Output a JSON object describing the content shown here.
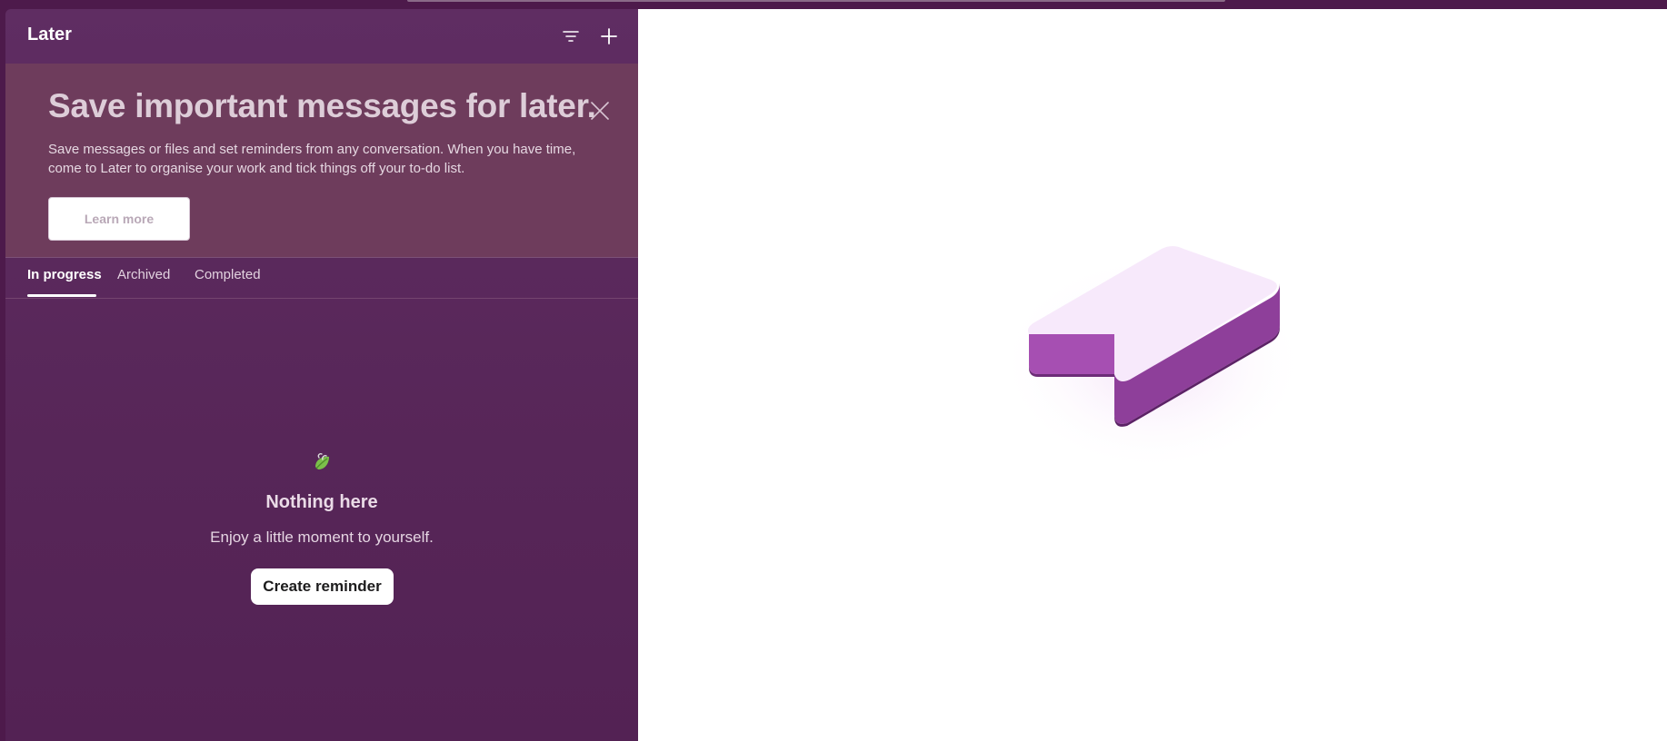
{
  "header": {
    "title": "Later",
    "filter_icon": "filter-icon",
    "add_icon": "plus-icon"
  },
  "banner": {
    "headline": "Save important messages for later.",
    "description": "Save messages or files and set reminders from any conversation. When you have time, come to Later to organise your work and tick things off your to-do list.",
    "learn_more_label": "Learn more",
    "close_icon": "close-icon"
  },
  "tabs": [
    {
      "label": "In progress",
      "active": true
    },
    {
      "label": "Archived",
      "active": false
    },
    {
      "label": "Completed",
      "active": false
    }
  ],
  "empty_state": {
    "icon": "leaf-icon",
    "title": "Nothing here",
    "subtitle": "Enjoy a little moment to yourself.",
    "button_label": "Create reminder"
  },
  "illustration": {
    "icon": "bookmark-illustration"
  },
  "colors": {
    "sidebar_bg": "#5a285b",
    "banner_bg": "#6e3c5c",
    "accent_purple": "#9b4ea8",
    "bookmark_top": "#f7e9fb"
  }
}
